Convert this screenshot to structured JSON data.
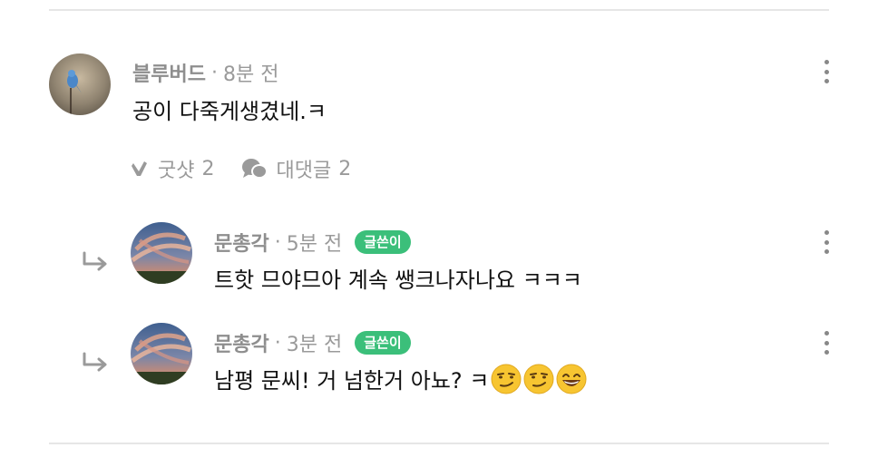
{
  "comment": {
    "nickname": "블루버드",
    "time": "8분 전",
    "text": "공이 다죽게생겼네.ㅋ",
    "like_label": "굿샷",
    "like_count": "2",
    "reply_label": "대댓글",
    "reply_count": "2"
  },
  "replies": [
    {
      "nickname": "문총각",
      "time": "5분 전",
      "badge": "글쓴이",
      "text": "트핫 므야므아 계속 쌩크나자나요 ㅋㅋㅋ"
    },
    {
      "nickname": "문총각",
      "time": "3분 전",
      "badge": "글쓴이",
      "text": "남평 문씨! 거 넘한거 아뇨? ㅋ",
      "emojis": [
        "smirk-emoji",
        "smirk-emoji",
        "grin-emoji"
      ]
    }
  ],
  "separator_dot": "·",
  "colors": {
    "badge": "#3bbf7a",
    "muted": "#9a9a9a",
    "divider": "#e6e6e6"
  }
}
